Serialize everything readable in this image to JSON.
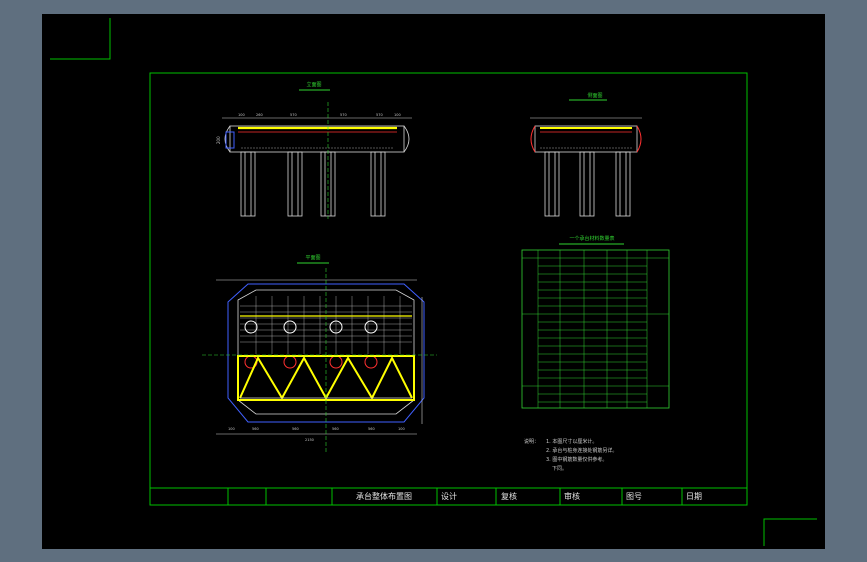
{
  "drawing": {
    "view_front_title": "立面图",
    "view_side_title": "侧面图",
    "view_plan_title": "平面图",
    "table_title": "一个承台材料数量表",
    "notes_header": "说明：",
    "notes": [
      "1. 本图尺寸以厘米计。",
      "2. 承台与桩身连接处钢筋另详。",
      "3. 图中钢筋数量仅供参考。",
      "下同。"
    ],
    "title_block": {
      "drawing_name": "承台整体布置图",
      "design_label": "设计",
      "check_label": "复核",
      "review_label": "审核",
      "number_label": "图号",
      "date_label": "日期"
    }
  },
  "colors": {
    "background": "#000000",
    "frame": "#00c000",
    "lines": "#d0d0d0",
    "highlight_yellow": "#ffff00",
    "rebar_red": "#ff3030",
    "hatch_magenta": "#ff40ff",
    "blue": "#4060ff"
  }
}
